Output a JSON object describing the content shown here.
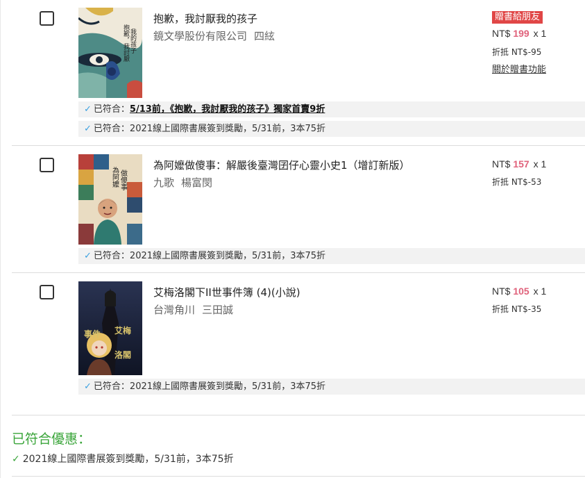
{
  "items": [
    {
      "title": "抱歉，我討厭我的孩子",
      "publisher": "鏡文學股份有限公司",
      "author": "四絃",
      "currency": "NT$",
      "price": "199",
      "qty": "x 1",
      "discount": "折抵 NT$-95",
      "gift_badge": "贈書給朋友",
      "gift_link": "關於贈書功能",
      "cover_text": "抱歉，我討厭我的孩子",
      "promos": [
        {
          "label": "已符合：",
          "text": "5/13前，《抱歉，我討厭我的孩子》獨家首賣9折",
          "bold": true
        },
        {
          "label": "已符合：",
          "text": "2021線上國際書展簽到獎勵，5/31前，3本75折",
          "bold": false
        }
      ]
    },
    {
      "title": "為阿嬤做傻事：解嚴後臺灣囝仔心靈小史1（增訂新版）",
      "publisher": "九歌",
      "author": "楊富閔",
      "currency": "NT$",
      "price": "157",
      "qty": "x 1",
      "discount": "折抵 NT$-53",
      "cover_text": "為阿嬤做傻事",
      "promos": [
        {
          "label": "已符合：",
          "text": "2021線上國際書展簽到獎勵，5/31前，3本75折",
          "bold": false
        }
      ]
    },
    {
      "title": "艾梅洛閣下II世事件簿 (4)(小說)",
      "publisher": "台灣角川",
      "author": "三田誠",
      "currency": "NT$",
      "price": "105",
      "qty": "x 1",
      "discount": "折抵 NT$-35",
      "cover_text": "艾梅洛閣下II世",
      "promos": [
        {
          "label": "已符合：",
          "text": "2021線上國際書展簽到獎勵，5/31前，3本75折",
          "bold": false
        }
      ]
    }
  ],
  "applied": {
    "title": "已符合優惠：",
    "items": [
      "2021線上國際書展簽到獎勵，5/31前，3本75折"
    ]
  },
  "colors": {
    "price_accent": "#e0627b",
    "gift_badge_bg": "#e04646",
    "check_blue": "#3aa0e0",
    "applied_green": "#3aa53a"
  },
  "icons": {
    "checkmark": "✓"
  }
}
